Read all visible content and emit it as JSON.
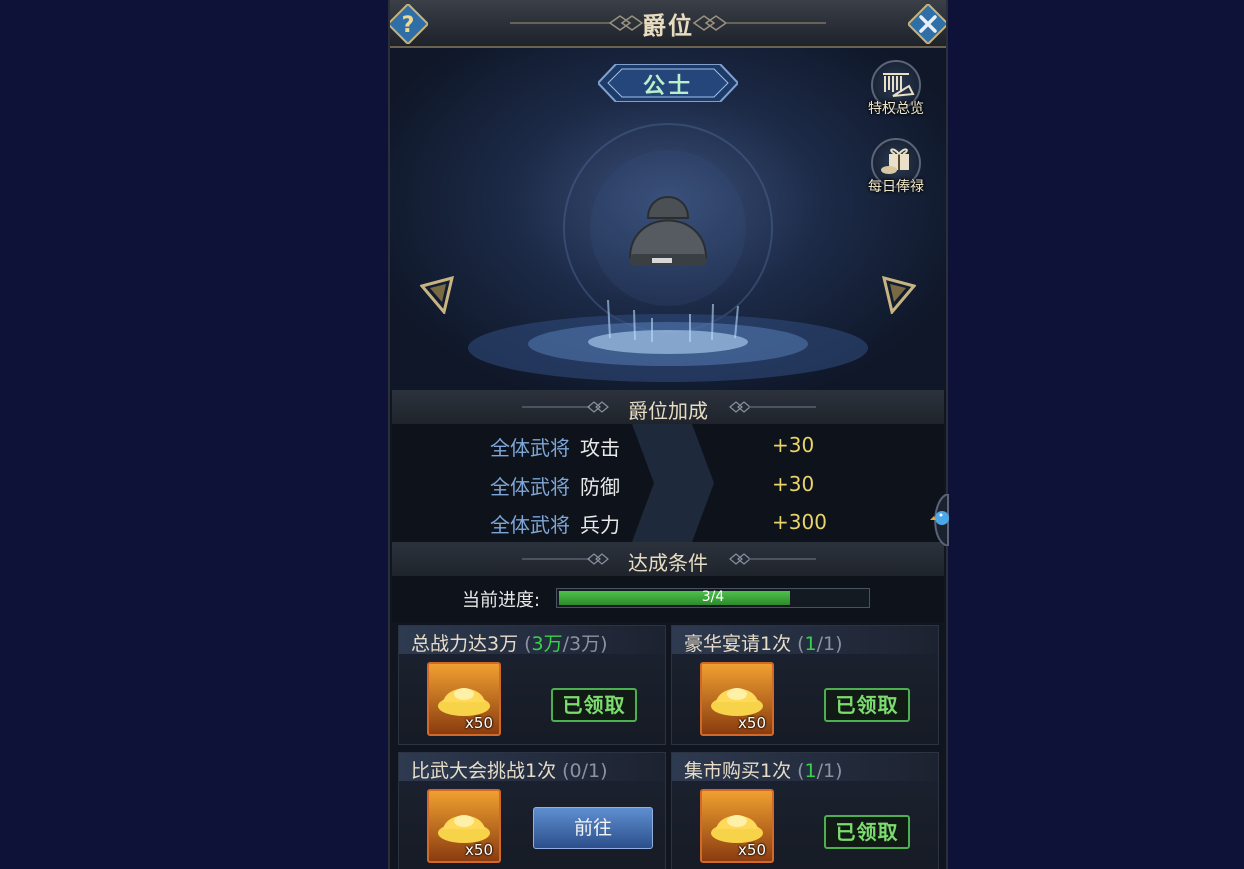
{
  "window": {
    "title": "爵位"
  },
  "rank": {
    "name": "公士"
  },
  "side_buttons": [
    {
      "label": "特权总览",
      "icon": "scroll-rack-icon"
    },
    {
      "label": "每日俸禄",
      "icon": "gift-box-icon"
    }
  ],
  "bonus_section": {
    "title": "爵位加成",
    "rows": [
      {
        "who": "全体武将",
        "stat": "攻击",
        "value": "+30"
      },
      {
        "who": "全体武将",
        "stat": "防御",
        "value": "+30"
      },
      {
        "who": "全体武将",
        "stat": "兵力",
        "value": "+300"
      }
    ]
  },
  "conditions_section": {
    "title": "达成条件",
    "progress_label": "当前进度:",
    "progress_text": "3/4",
    "progress_fraction": 0.75
  },
  "tasks": [
    {
      "title": "总战力达3万",
      "open": " (",
      "current": "3万",
      "total": "/3万)",
      "reward_qty": "x50",
      "status": "已领取",
      "action": ""
    },
    {
      "title": "豪华宴请1次",
      "open": " (",
      "current": "1",
      "total": "/1)",
      "reward_qty": "x50",
      "status": "已领取",
      "action": ""
    },
    {
      "title": "比武大会挑战1次",
      "open": " (",
      "current": "0",
      "total": "/1)",
      "reward_qty": "x50",
      "status": "",
      "action": "前往"
    },
    {
      "title": "集市购买1次",
      "open": " (",
      "current": "1",
      "total": "/1)",
      "reward_qty": "x50",
      "status": "已领取",
      "action": ""
    }
  ],
  "colors": {
    "background": "#0f1238",
    "progress_green": "#37d24a",
    "bonus_value": "#e8d46a",
    "bonus_who": "#7fa6d8"
  }
}
